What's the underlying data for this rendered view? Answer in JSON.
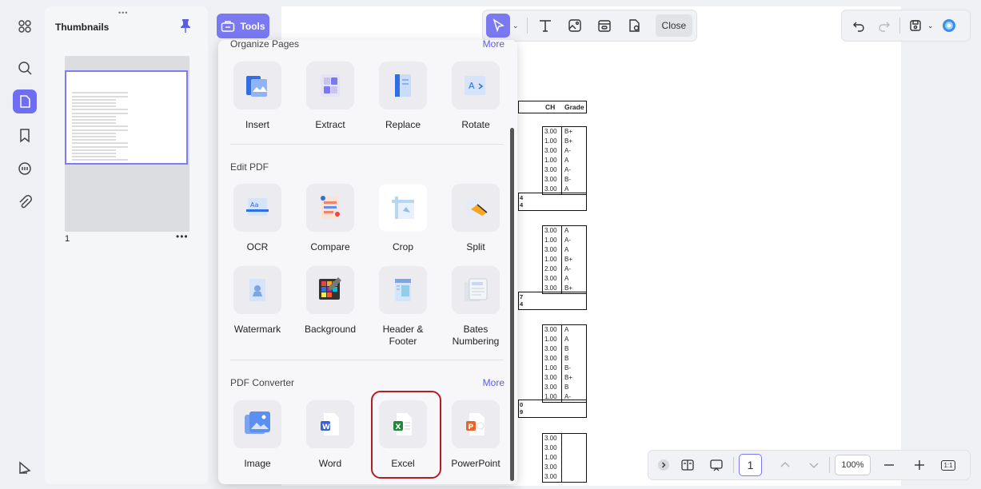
{
  "thumbnails": {
    "title": "Thumbnails",
    "grip": "•••",
    "page_number": "1",
    "more": "•••"
  },
  "tools_button": {
    "label": "Tools"
  },
  "toolbar": {
    "close_label": "Close",
    "caret": "⌄"
  },
  "document": {
    "headers": [
      "CH",
      "Grade"
    ],
    "blocks": [
      {
        "rows": [
          [
            "3.00",
            "B+"
          ],
          [
            "1.00",
            "B+"
          ],
          [
            "3.00",
            "A-"
          ],
          [
            "1.00",
            "A"
          ],
          [
            "3.00",
            "A-"
          ],
          [
            "3.00",
            "B-"
          ],
          [
            "3.00",
            "A"
          ]
        ],
        "summary": [
          "4",
          "4"
        ]
      },
      {
        "rows": [
          [
            "3.00",
            "A"
          ],
          [
            "1.00",
            "A-"
          ],
          [
            "3.00",
            "A"
          ],
          [
            "1.00",
            "B+"
          ],
          [
            "2.00",
            "A-"
          ],
          [
            "3.00",
            "A"
          ],
          [
            "3.00",
            "B+"
          ]
        ],
        "summary": [
          "7",
          "4"
        ]
      },
      {
        "rows": [
          [
            "3.00",
            "A"
          ],
          [
            "1.00",
            "A"
          ],
          [
            "3.00",
            "B"
          ],
          [
            "3.00",
            "B"
          ],
          [
            "1.00",
            "B-"
          ],
          [
            "3.00",
            "B+"
          ],
          [
            "3.00",
            "B"
          ],
          [
            "1.00",
            "A-"
          ]
        ],
        "summary": [
          "0",
          "9"
        ]
      },
      {
        "rows": [
          [
            "3.00",
            ""
          ],
          [
            "3.00",
            ""
          ],
          [
            "1.00",
            ""
          ],
          [
            "3.00",
            ""
          ],
          [
            "3.00",
            ""
          ]
        ],
        "summary": []
      }
    ]
  },
  "popup": {
    "organize": {
      "title": "Organize Pages",
      "more": "More",
      "tools": [
        "Insert",
        "Extract",
        "Replace",
        "Rotate"
      ]
    },
    "edit": {
      "title": "Edit PDF",
      "tools_row1": [
        "OCR",
        "Compare",
        "Crop",
        "Split"
      ],
      "tools_row2": [
        "Watermark",
        "Background",
        "Header &\nFooter",
        "Bates\nNumbering"
      ]
    },
    "converter": {
      "title": "PDF Converter",
      "more": "More",
      "tools": [
        "Image",
        "Word",
        "Excel",
        "PowerPoint"
      ]
    }
  },
  "bottombar": {
    "page": "1",
    "zoom": "100%",
    "fit_label": "1:1"
  },
  "colors": {
    "accent": "#7b79f2",
    "highlight": "#b21d24",
    "link": "#5b5ce6"
  }
}
